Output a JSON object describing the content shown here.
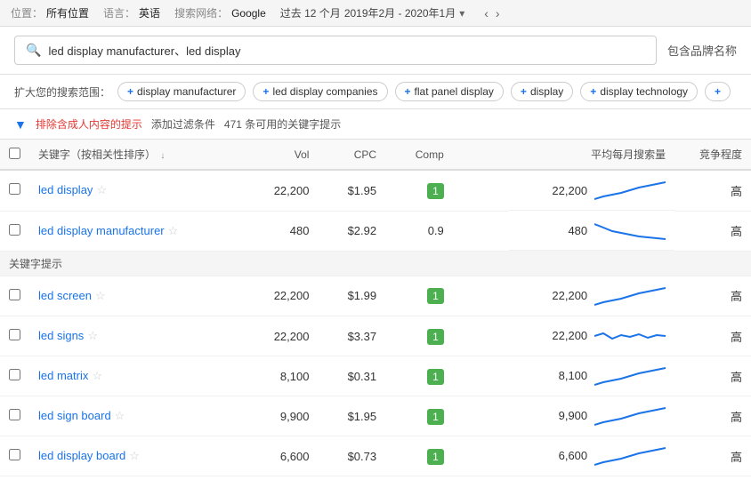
{
  "topbar": {
    "location_label": "位置：",
    "location_value": "所有位置",
    "lang_label": "语言：",
    "lang_value": "英语",
    "network_label": "搜索网络：",
    "network_value": "Google",
    "period_label": "过去 12 个月",
    "date_range": "2019年2月 - 2020年1月"
  },
  "search": {
    "query": "led display manufacturer、led display",
    "brand_label": "包含品牌名称"
  },
  "expand": {
    "label": "扩大您的搜索范围：",
    "chips": [
      "display manufacturer",
      "led display companies",
      "flat panel display",
      "display",
      "display technology"
    ]
  },
  "filter": {
    "filter_link": "排除含成人内容的提示",
    "add_filter": "添加过滤条件",
    "count_text": "471 条可用的关键字提示"
  },
  "table": {
    "columns": {
      "keyword": "关键字（按相关性排序）",
      "vol": "Vol",
      "cpc": "CPC",
      "comp": "Comp",
      "monthly": "平均每月搜索量",
      "competition": "竞争程度"
    },
    "main_rows": [
      {
        "keyword": "led display",
        "vol": "22,200",
        "cpc": "$1.95",
        "comp": "1",
        "comp_class": "green",
        "monthly_vol": "22,200",
        "competition": "高",
        "sparkline": "up"
      },
      {
        "keyword": "led display manufacturer",
        "vol": "480",
        "cpc": "$2.92",
        "comp": "0.9",
        "comp_class": "none",
        "monthly_vol": "480",
        "competition": "高",
        "sparkline": "down"
      }
    ],
    "section_label": "关键字提示",
    "suggestion_rows": [
      {
        "keyword": "led screen",
        "vol": "22,200",
        "cpc": "$1.99",
        "comp": "1",
        "comp_class": "green",
        "monthly_vol": "22,200",
        "competition": "高",
        "sparkline": "up"
      },
      {
        "keyword": "led signs",
        "vol": "22,200",
        "cpc": "$3.37",
        "comp": "1",
        "comp_class": "green",
        "monthly_vol": "22,200",
        "competition": "高",
        "sparkline": "flat"
      },
      {
        "keyword": "led matrix",
        "vol": "8,100",
        "cpc": "$0.31",
        "comp": "1",
        "comp_class": "green",
        "monthly_vol": "8,100",
        "competition": "高",
        "sparkline": "up"
      },
      {
        "keyword": "led sign board",
        "vol": "9,900",
        "cpc": "$1.95",
        "comp": "1",
        "comp_class": "green",
        "monthly_vol": "9,900",
        "competition": "高",
        "sparkline": "up"
      },
      {
        "keyword": "led display board",
        "vol": "6,600",
        "cpc": "$0.73",
        "comp": "1",
        "comp_class": "green",
        "monthly_vol": "6,600",
        "competition": "高",
        "sparkline": "up"
      }
    ]
  }
}
